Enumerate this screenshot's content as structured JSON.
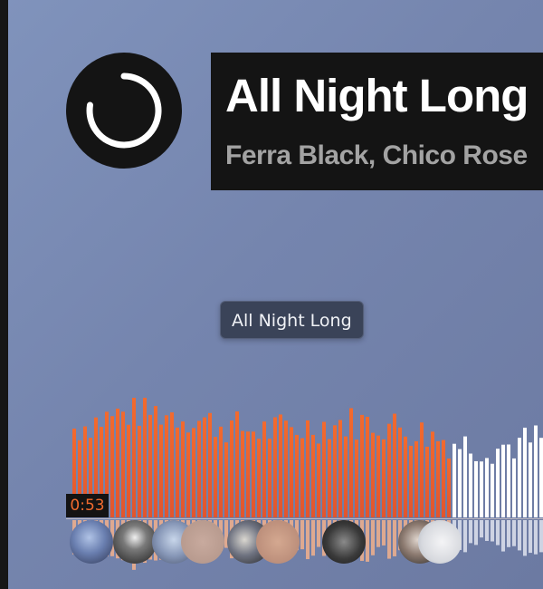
{
  "track": {
    "title": "All Night Long",
    "artists": "Ferra Black, Chico Rose"
  },
  "player": {
    "state_icon": "loading-spinner-icon",
    "current_time": "0:53",
    "progress_fraction": 0.69
  },
  "tooltip": {
    "text": "All Night Long"
  },
  "colors": {
    "played_top": "#f26a2e",
    "played_bottom": "#e1552e",
    "played_reflection": "#f2b08c",
    "unplayed": "#ffffff",
    "unplayed_reflection": "#dfe3ee"
  },
  "comment_avatars": [
    {
      "name": "commenter-1"
    },
    {
      "name": "commenter-2"
    },
    {
      "name": "commenter-3"
    },
    {
      "name": "commenter-4"
    },
    {
      "name": "commenter-5"
    },
    {
      "name": "commenter-6"
    },
    {
      "name": "commenter-7"
    },
    {
      "name": "commenter-8"
    }
  ]
}
